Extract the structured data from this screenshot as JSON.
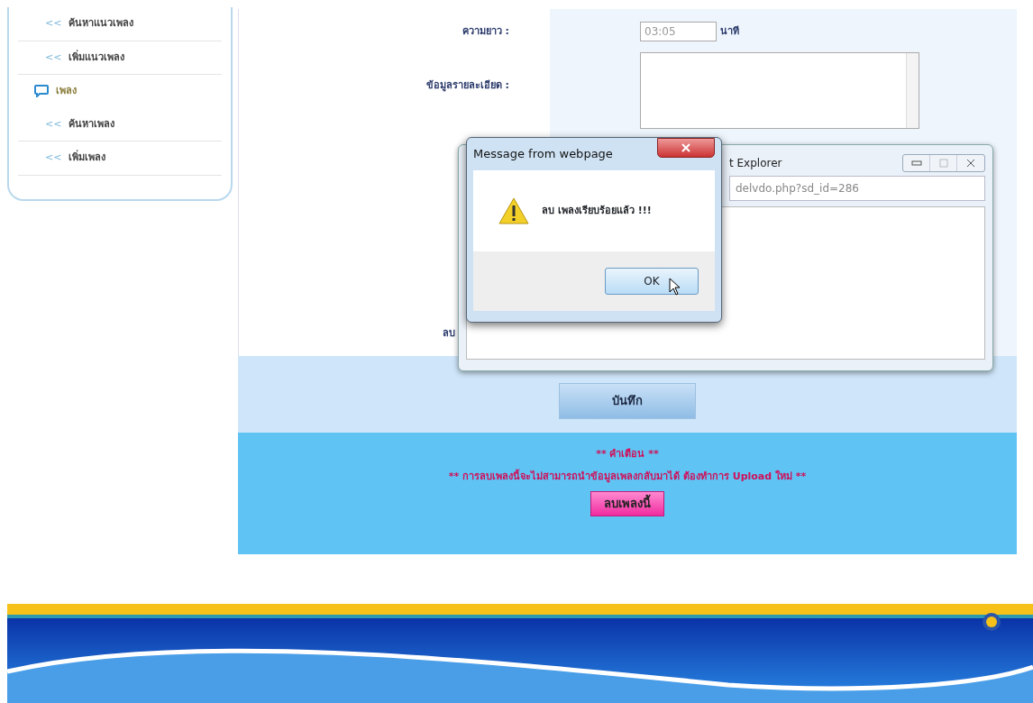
{
  "sidebar": {
    "items": [
      {
        "kind": "link",
        "marker": "<<",
        "label": "ค้นหาแนวเพลง"
      },
      {
        "kind": "link",
        "marker": "<<",
        "label": "เพิ่มแนวเพลง"
      },
      {
        "kind": "header",
        "label": "เพลง"
      },
      {
        "kind": "link",
        "marker": "<<",
        "label": "ค้นหาเพลง"
      },
      {
        "kind": "link",
        "marker": "<<",
        "label": "เพิ่มเพลง"
      }
    ]
  },
  "form": {
    "fields": [
      {
        "kind": "duration",
        "label": "ความยาว :",
        "value": "03:05",
        "unit": "นาที"
      },
      {
        "kind": "textarea",
        "label": "ข้อมูลรายละเอียด :"
      },
      {
        "kind": "cut",
        "label": "ลบ"
      }
    ],
    "save_button": "บันทึก"
  },
  "warning": {
    "title": "** คำเตือน **",
    "message": "** การลบเพลงนี้จะไม่สามารถนำข้อมูลเพลงกลับมาได้ ต้องทำการ Upload ใหม่ **",
    "delete_button": "ลบเพลงนี้"
  },
  "browser_window": {
    "title": "t Explorer",
    "address": "delvdo.php?sd_id=286"
  },
  "message_box": {
    "title": "Message from webpage",
    "message": "ลบ เพลงเรียบร้อยแล้ว !!!",
    "ok_button": "OK"
  }
}
